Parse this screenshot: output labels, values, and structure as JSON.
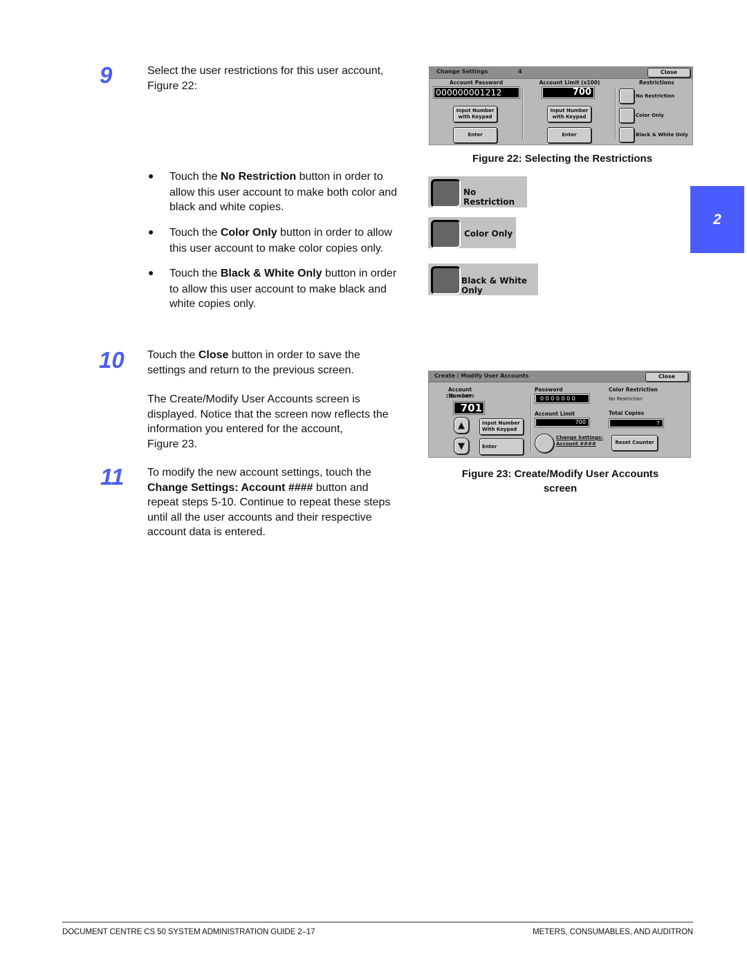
{
  "steps": [
    {
      "number": "9",
      "intro": [
        "Select the user restrictions for this user account,",
        "Figure 22:"
      ],
      "bullets": [
        {
          "prefix": "Touch the ",
          "bold": "No Restriction",
          "line1_suffix": " button in order to",
          "rest": [
            "allow this user account to make both color and",
            "black and white copies."
          ]
        },
        {
          "prefix": "Touch the ",
          "bold": "Color Only",
          "line1_suffix": " button in order to allow",
          "rest": [
            "this user account to make color copies only."
          ]
        },
        {
          "prefix": "Touch the ",
          "bold": "Black & White Only",
          "line1_suffix": " button in order",
          "rest": [
            "to allow this user account to make black and",
            "white copies only."
          ]
        }
      ]
    },
    {
      "number": "10",
      "line1_prefix": "Touch the ",
      "line1_bold": "Close",
      "line1_suffix": " button in order to save the",
      "line2": "settings and return to the previous screen.",
      "note": [
        "The Create/Modify User Accounts screen is",
        "displayed.  Notice that the screen now reflects the",
        "information you entered for the account,",
        "Figure 23."
      ]
    },
    {
      "number": "11",
      "line1": "To modify the new account settings, touch the",
      "line2_bold": "Change Settings: Account ####",
      "line2_suffix": " button and",
      "rest": [
        "repeat steps 5-10. Continue to repeat these steps",
        "until all the user accounts and their respective",
        "account data is entered."
      ]
    }
  ],
  "figure22": {
    "caption": "Figure 22: Selecting the Restrictions",
    "screen": {
      "title": "Change Settings",
      "title_number": "4",
      "close_label": "Close",
      "account_password_label": "Account Password",
      "account_password_value": "000000001212",
      "account_limit_label": "Account Limit (x100)",
      "account_limit_value": "700",
      "input_keypad_label": "Input Number with Keypad",
      "enter_label": "Enter",
      "restrictions_label": "Restrictions",
      "restriction_options": [
        "No Restriction",
        "Color Only",
        "Black & White Only"
      ]
    },
    "enlarged_options": [
      "No Restriction",
      "Color Only",
      "Black & White Only"
    ]
  },
  "figure23": {
    "caption_line1": "Figure 23: Create/Modify User Accounts",
    "caption_line2": "screen",
    "screen": {
      "title": "Create / Modify User Accounts",
      "close_label": "Close",
      "account_number_label": "Account Number",
      "account_range": "100 → 2099",
      "account_number_value": "701",
      "input_keypad_label": "Input Number With Keypad",
      "enter_label": "Enter",
      "password_label": "Password",
      "password_value": "0 0 0 0 0 0 0",
      "account_limit_label": "Account Limit",
      "account_limit_value": "700",
      "change_settings_line1": "Change Settings:",
      "change_settings_line2": "Account ####",
      "color_restriction_label": "Color Restriction",
      "color_restriction_value": "No Restriction",
      "total_copies_label": "Total Copies",
      "total_copies_value": "7",
      "reset_counter_label": "Reset Counter"
    }
  },
  "side_tab": {
    "label": "2",
    "color": "#4b5cff"
  },
  "footer": {
    "left": "DOCUMENT CENTRE CS 50 SYSTEM ADMINISTRATION GUIDE 2–17",
    "right": "METERS, CONSUMABLES, AND AUDITRON"
  },
  "colors": {
    "step_number": "#4a5ef0",
    "panel_bg": "#b9b9b9",
    "titlebar_bg": "#8e8e8e"
  }
}
